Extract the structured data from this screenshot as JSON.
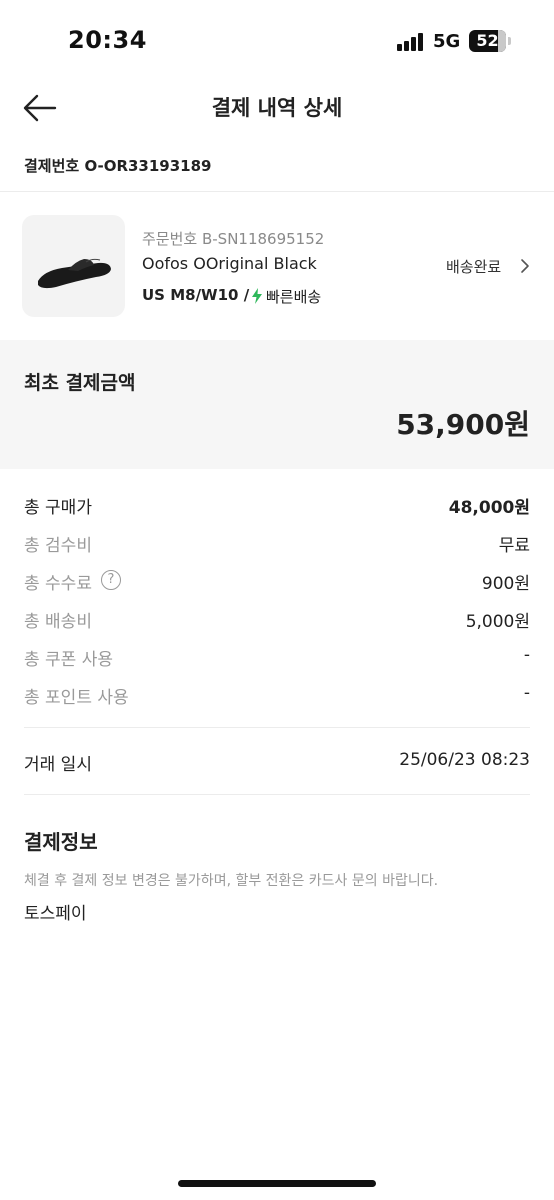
{
  "status_bar": {
    "time": "20:34",
    "network": "5G",
    "battery": "52"
  },
  "header": {
    "title": "결제 내역 상세"
  },
  "order": {
    "label": "결제번호",
    "number": "O-OR33193189"
  },
  "product": {
    "sub_order": "주문번호 B-SN118695152",
    "name": "Oofos OOriginal Black",
    "option": "US M8/W10 /",
    "delivery_type": "빠른배송",
    "status": "배송완료"
  },
  "total": {
    "label": "최초 결제금액",
    "amount": "53,900원"
  },
  "breakdown": [
    {
      "label": "총 구매가",
      "value": "48,000원"
    },
    {
      "label": "총 검수비",
      "value": "무료"
    },
    {
      "label": "총 수수료",
      "value": "900원"
    },
    {
      "label": "총 배송비",
      "value": "5,000원"
    },
    {
      "label": "총 쿠폰 사용",
      "value": "-"
    },
    {
      "label": "총 포인트 사용",
      "value": "-"
    }
  ],
  "transaction": {
    "label": "거래 일시",
    "value": "25/06/23 08:23"
  },
  "payment_info": {
    "title": "결제정보",
    "notice": "체결 후 결제 정보 변경은 불가하며, 할부 전환은 카드사 문의 바랍니다.",
    "method": "토스페이"
  },
  "colors": {
    "accent_green": "#2fb85b",
    "text": "#222222",
    "muted": "#9a9a9a",
    "panel": "#f6f6f6"
  }
}
